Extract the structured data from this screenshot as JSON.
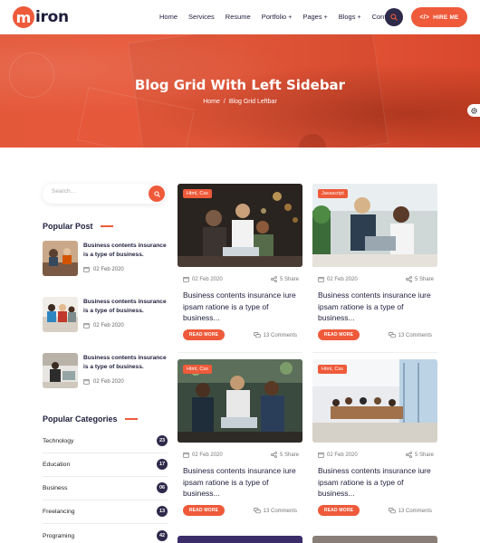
{
  "brand": {
    "logo_letter": "m",
    "logo_rest": "iron"
  },
  "nav": {
    "items": [
      {
        "label": "Home",
        "has_sub": false
      },
      {
        "label": "Services",
        "has_sub": false
      },
      {
        "label": "Resume",
        "has_sub": false
      },
      {
        "label": "Portfolio",
        "has_sub": true
      },
      {
        "label": "Pages",
        "has_sub": true
      },
      {
        "label": "Blogs",
        "has_sub": true
      },
      {
        "label": "Contact",
        "has_sub": false
      }
    ],
    "plus": "+",
    "hire_label": "HIRE ME",
    "hire_icon": "</>"
  },
  "hero": {
    "title": "Blog Grid With Left Sidebar",
    "breadcrumb_home": "Home",
    "breadcrumb_sep": "/",
    "breadcrumb_current": "Blog Grid Leftbar"
  },
  "sidebar": {
    "search_placeholder": "Search...",
    "popular_post_title": "Popular Post",
    "posts": [
      {
        "title": "Business contents insurance is a type of business.",
        "date": "02 Feb 2020"
      },
      {
        "title": "Business contents insurance is a type of business.",
        "date": "02 Feb 2020"
      },
      {
        "title": "Business contents insurance is a type of business.",
        "date": "02 Feb 2020"
      }
    ],
    "categories_title": "Popular Categories",
    "categories": [
      {
        "label": "Technology",
        "count": "23"
      },
      {
        "label": "Education",
        "count": "17"
      },
      {
        "label": "Business",
        "count": "06"
      },
      {
        "label": "Freelancing",
        "count": "13"
      },
      {
        "label": "Programing",
        "count": "42"
      }
    ]
  },
  "cards": [
    {
      "tag": "Html, Css",
      "date": "02 Feb 2020",
      "share": "5 Share",
      "title": "Business contents insurance iure ipsam ratione is a type of business...",
      "read_more": "READ MORE",
      "comments": "13 Comments"
    },
    {
      "tag": "Javascript",
      "date": "02 Feb 2020",
      "share": "5 Share",
      "title": "Business contents insurance iure ipsam ratione is a type of business...",
      "read_more": "READ MORE",
      "comments": "13 Comments"
    },
    {
      "tag": "Html, Css",
      "date": "02 Feb 2020",
      "share": "5 Share",
      "title": "Business contents insurance iure ipsam ratione is a type of business...",
      "read_more": "READ MORE",
      "comments": "13 Comments"
    },
    {
      "tag": "Html, Css",
      "date": "02 Feb 2020",
      "share": "5 Share",
      "title": "Business contents insurance iure ipsam ratione is a type of business...",
      "read_more": "READ MORE",
      "comments": "13 Comments"
    }
  ],
  "colors": {
    "accent": "#ee5a3a",
    "dark": "#2e2a4a",
    "heading": "#1e1e3c"
  }
}
